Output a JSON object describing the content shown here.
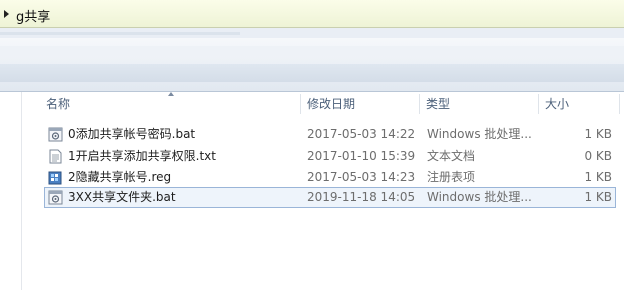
{
  "address": {
    "path": "g共享"
  },
  "columns": {
    "name": "名称",
    "date": "修改日期",
    "type": "类型",
    "size": "大小"
  },
  "files": [
    {
      "name": "0添加共享帐号密码.bat",
      "date": "2017-05-03 14:22",
      "type": "Windows 批处理...",
      "size": "1 KB",
      "icon": "batch-file-icon"
    },
    {
      "name": "1开启共享添加共享权限.txt",
      "date": "2017-01-10 15:39",
      "type": "文本文档",
      "size": "0 KB",
      "icon": "text-file-icon"
    },
    {
      "name": "2隐藏共享帐号.reg",
      "date": "2017-05-03 14:23",
      "type": "注册表项",
      "size": "1 KB",
      "icon": "registry-file-icon"
    },
    {
      "name": "3XX共享文件夹.bat",
      "date": "2019-11-18 14:05",
      "type": "Windows 批处理...",
      "size": "1 KB",
      "icon": "batch-file-icon",
      "selected": true
    }
  ]
}
